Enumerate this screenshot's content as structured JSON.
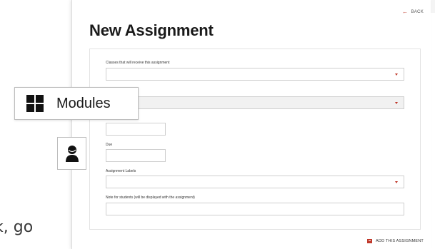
{
  "background": {
    "partial_text": "k, go"
  },
  "header": {
    "back_label": "BACK",
    "title": "New Assignment"
  },
  "form": {
    "classes_label": "Classes that will receive this assignment",
    "due_label": "Due",
    "assignment_labels_label": "Assignment Labels",
    "note_label": "Note for students (will be displayed with the assignment)",
    "submit_label": "ADD THIS ASSIGNMENT"
  },
  "overlay": {
    "modules_label": "Modules"
  },
  "colors": {
    "accent": "#c0392b",
    "text": "#1a1a1a"
  },
  "icons": [
    "back-arrow-icon",
    "modules-grid-icon",
    "person-icon",
    "add-assignment-icon",
    "dropdown-caret-icon"
  ]
}
